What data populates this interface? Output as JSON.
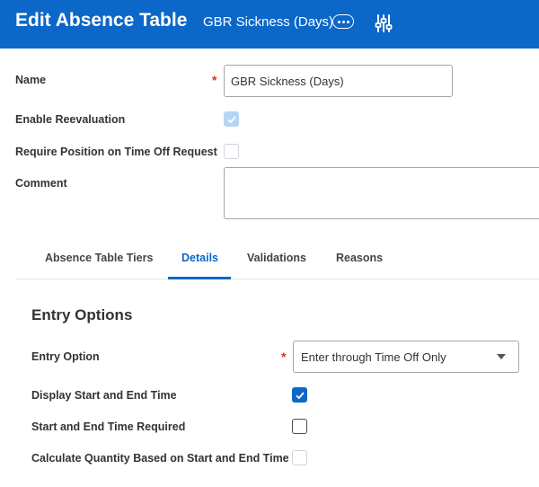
{
  "header": {
    "title": "Edit Absence Table",
    "subtitle": "GBR Sickness (Days)",
    "more_icon": "more-horizontal-icon",
    "settings_icon": "sliders-icon",
    "color": "#0b67c8"
  },
  "form": {
    "name_label": "Name",
    "name_value": "GBR Sickness (Days)",
    "required_mark": "*",
    "enable_reevaluation_label": "Enable Reevaluation",
    "enable_reevaluation_checked": true,
    "require_position_label": "Require Position on Time Off Request",
    "require_position_checked": false,
    "comment_label": "Comment",
    "comment_value": ""
  },
  "tabs": [
    {
      "label": "Absence Table Tiers",
      "active": false
    },
    {
      "label": "Details",
      "active": true
    },
    {
      "label": "Validations",
      "active": false
    },
    {
      "label": "Reasons",
      "active": false
    }
  ],
  "entry_options": {
    "title": "Entry Options",
    "entry_option_label": "Entry Option",
    "entry_option_value": "Enter through Time Off Only",
    "display_start_end_label": "Display Start and End Time",
    "display_start_end_checked": true,
    "start_end_required_label": "Start and End Time Required",
    "start_end_required_checked": false,
    "calculate_quantity_label": "Calculate Quantity Based on Start and End Time",
    "calculate_quantity_checked": false
  }
}
